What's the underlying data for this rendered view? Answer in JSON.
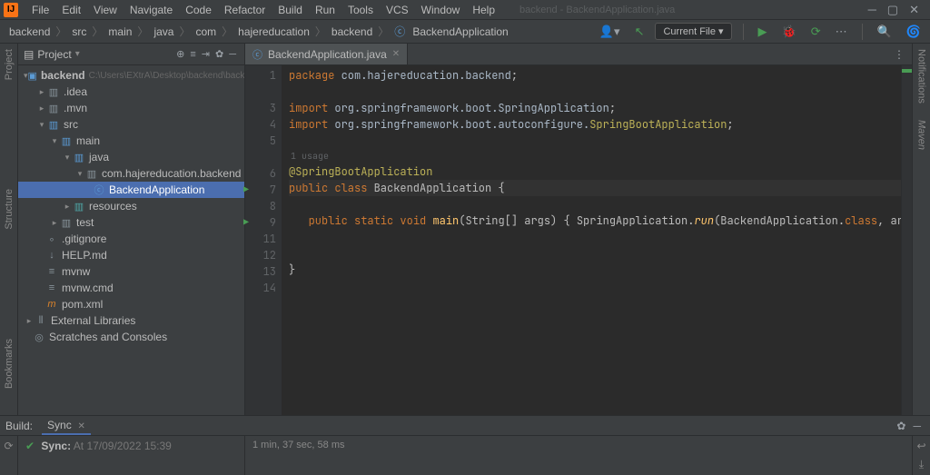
{
  "app": {
    "logo_letter": "IJ",
    "window_title": "backend - BackendApplication.java"
  },
  "menu": {
    "file": "File",
    "edit": "Edit",
    "view": "View",
    "navigate": "Navigate",
    "code": "Code",
    "refactor": "Refactor",
    "build": "Build",
    "run": "Run",
    "tools": "Tools",
    "vcs": "VCS",
    "window": "Window",
    "help": "Help"
  },
  "breadcrumbs": [
    "backend",
    "src",
    "main",
    "java",
    "com",
    "hajereducation",
    "backend",
    "BackendApplication"
  ],
  "runcfg": {
    "label": "Current File"
  },
  "left_gutter": {
    "project": "Project",
    "structure": "Structure",
    "bookmarks": "Bookmarks"
  },
  "right_gutter": {
    "notifications": "Notifications",
    "maven": "Maven"
  },
  "project_panel": {
    "title": "Project",
    "root": {
      "name": "backend",
      "path": "C:\\Users\\EXtrA\\Desktop\\backend\\backend"
    },
    "nodes": {
      "idea": ".idea",
      "mvn": ".mvn",
      "src": "src",
      "main": "main",
      "java": "java",
      "pkg": "com.hajereducation.backend",
      "cls": "BackendApplication",
      "resources": "resources",
      "test": "test",
      "gitignore": ".gitignore",
      "helpmd": "HELP.md",
      "mvnw": "mvnw",
      "mvnwcmd": "mvnw.cmd",
      "pomxml": "pom.xml",
      "extlib": "External Libraries",
      "scratches": "Scratches and Consoles"
    }
  },
  "editor": {
    "tab": "BackendApplication.java",
    "usage_hint": "1 usage",
    "lines": {
      "1": {
        "num": "1",
        "tokens": [
          [
            "kw",
            "package "
          ],
          [
            "pkg2",
            "com.hajereducation.backend"
          ],
          [
            "dot",
            ";"
          ]
        ]
      },
      "2": {
        "num": ""
      },
      "3": {
        "num": "3",
        "tokens": [
          [
            "kw",
            "import "
          ],
          [
            "pkg2",
            "org.springframework.boot.SpringApplication"
          ],
          [
            "dot",
            ";"
          ]
        ]
      },
      "4": {
        "num": "4",
        "tokens": [
          [
            "kw",
            "import "
          ],
          [
            "pkg2",
            "org.springframework.boot.autoconfigure."
          ],
          [
            "ann",
            "SpringBootApplication"
          ],
          [
            "dot",
            ";"
          ]
        ]
      },
      "5": {
        "num": "5"
      },
      "6": {
        "num": "6",
        "tokens": [
          [
            "ann",
            "@SpringBootApplication"
          ]
        ]
      },
      "7": {
        "num": "7",
        "tokens": [
          [
            "kw",
            "public class "
          ],
          [
            "cls2",
            "BackendApplication "
          ],
          [
            "dot",
            "{"
          ]
        ]
      },
      "8": {
        "num": "8"
      },
      "9": {
        "num": "9",
        "tokens": [
          [
            "str",
            "   "
          ],
          [
            "kw",
            "public static "
          ],
          [
            "kw",
            "void "
          ],
          [
            "mname",
            "main"
          ],
          [
            "dot",
            "(String[] args) "
          ],
          [
            "dot",
            "{ "
          ],
          [
            "cls2",
            "SpringApplication"
          ],
          [
            "dot",
            "."
          ],
          [
            "mstat",
            "run"
          ],
          [
            "dot",
            "(BackendApplication."
          ],
          [
            "kw",
            "class"
          ],
          [
            "dot",
            ", args); }"
          ]
        ]
      },
      "11": {
        "num": "11"
      },
      "12": {
        "num": "12"
      },
      "13": {
        "num": "13",
        "tokens": [
          [
            "dot",
            "}"
          ]
        ]
      },
      "14": {
        "num": "14"
      }
    }
  },
  "build": {
    "label": "Build:",
    "tab": "Sync",
    "sync_label": "Sync:",
    "sync_ts": "At 17/09/2022 15:39",
    "duration": "1 min, 37 sec, 58 ms"
  }
}
